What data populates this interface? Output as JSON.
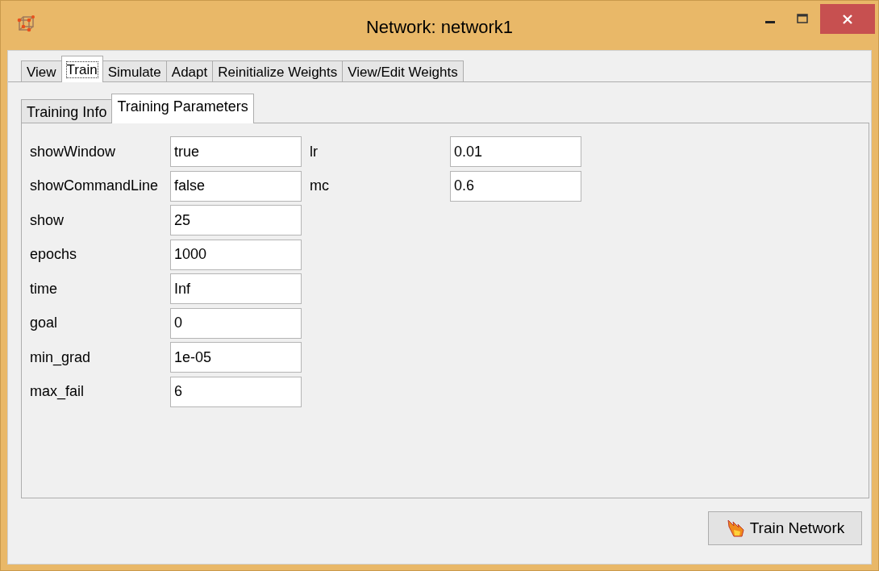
{
  "window": {
    "title": "Network: network1"
  },
  "tabs": [
    {
      "label": "View",
      "selected": false
    },
    {
      "label": "Train",
      "selected": true
    },
    {
      "label": "Simulate",
      "selected": false
    },
    {
      "label": "Adapt",
      "selected": false
    },
    {
      "label": "Reinitialize Weights",
      "selected": false
    },
    {
      "label": "View/Edit Weights",
      "selected": false
    }
  ],
  "subtabs": [
    {
      "label": "Training Info",
      "selected": false
    },
    {
      "label": "Training Parameters",
      "selected": true
    }
  ],
  "parameters": [
    [
      {
        "label": "showWindow",
        "value": "true"
      },
      {
        "label": "showCommandLine",
        "value": "false"
      },
      {
        "label": "show",
        "value": "25"
      },
      {
        "label": "epochs",
        "value": "1000"
      },
      {
        "label": "time",
        "value": "Inf"
      },
      {
        "label": "goal",
        "value": "0"
      },
      {
        "label": "min_grad",
        "value": "1e-05"
      },
      {
        "label": "max_fail",
        "value": "6"
      }
    ],
    [
      {
        "label": "lr",
        "value": "0.01"
      },
      {
        "label": "mc",
        "value": "0.6"
      }
    ]
  ],
  "buttons": [
    {
      "label": "Train Network"
    }
  ]
}
